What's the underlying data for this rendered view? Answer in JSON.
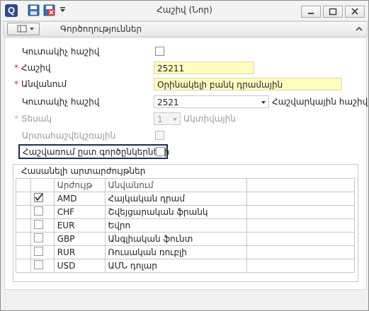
{
  "window": {
    "title": "Հաշիվ (Նոր)",
    "app_logo": "Q"
  },
  "ribbon": {
    "label": "Գործողություններ"
  },
  "form": {
    "summary_label": "Կուտակիչ հաշիվ",
    "account_label": "Հաշիվ",
    "account_value": "25211",
    "name_label": "Անվանում",
    "name_value": "Օրինակելի բանկ դրամային",
    "acc_label": "Կուտակիչ հաշիվ",
    "acc_value": "2521",
    "acc_type_label": "Հաշվարկային հաշիվ",
    "type_label": "Տեսակ",
    "type_value": "1",
    "type_desc": "Ակտիվային",
    "offbalance_label": "Արտահաշվեկշռային",
    "by_partners_label": "Հաշվառում ըստ գործընկերների"
  },
  "currencies": {
    "title": "Հասանելի արտարժույթներ",
    "columns": [
      "Արժույթ",
      "Անվանում"
    ],
    "rows": [
      {
        "code": "AMD",
        "name": "Հայկական դրամ",
        "checked": true
      },
      {
        "code": "CHF",
        "name": "Շվեյցարական ֆրանկ",
        "checked": false
      },
      {
        "code": "EUR",
        "name": "Եվրո",
        "checked": false
      },
      {
        "code": "GBP",
        "name": "Անգլիական ֆունտ",
        "checked": false
      },
      {
        "code": "RUR",
        "name": "Ռուսական ռուբլի",
        "checked": false
      },
      {
        "code": "USD",
        "name": "ԱՄՆ դոլար",
        "checked": false
      }
    ]
  },
  "icons": {
    "logo": "app-logo-icon",
    "save": "save-icon",
    "save_close": "save-close-icon",
    "menu": "dropdown-icon",
    "minimize": "minimize-icon",
    "maximize": "maximize-icon",
    "close": "close-icon",
    "collapse": "chevron-up-icon"
  },
  "colors": {
    "required_marker": "#d9251d",
    "required_field_bg": "#fefec0",
    "highlight_border": "#1d2a4d"
  }
}
